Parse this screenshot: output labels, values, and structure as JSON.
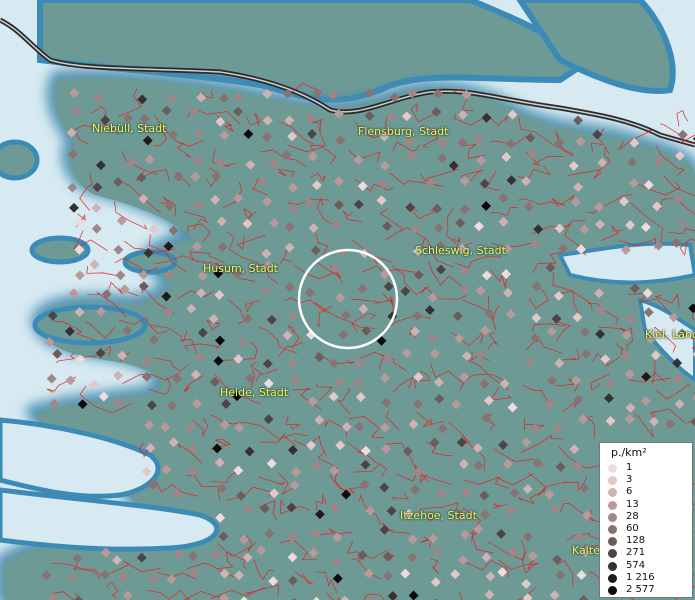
{
  "map": {
    "towns": [
      {
        "name": "Niebüll, Stadt"
      },
      {
        "name": "Flensburg, Stadt"
      },
      {
        "name": "Schleswig, Stadt"
      },
      {
        "name": "Husum, Stadt"
      },
      {
        "name": "Kiel, Lands"
      },
      {
        "name": "Heide, Stadt"
      },
      {
        "name": "Itzehoe, Stadt"
      },
      {
        "name": "Kalte"
      }
    ],
    "colors": {
      "sea": "#d8eaf1",
      "land": "#6e9a96",
      "boundary": "#e02424",
      "coastline": "#3b8bb6"
    }
  },
  "legend": {
    "title": "p./km²",
    "entries": [
      {
        "value": "1",
        "color": "#eedcdc"
      },
      {
        "value": "3",
        "color": "#e2c8c8"
      },
      {
        "value": "6",
        "color": "#cfb2b2"
      },
      {
        "value": "13",
        "color": "#b89a9a"
      },
      {
        "value": "28",
        "color": "#a08686"
      },
      {
        "value": "60",
        "color": "#887272"
      },
      {
        "value": "128",
        "color": "#6c5c5c"
      },
      {
        "value": "271",
        "color": "#4e4444"
      },
      {
        "value": "574",
        "color": "#363030"
      },
      {
        "value": "1 216",
        "color": "#1f1b1b"
      },
      {
        "value": "2 577",
        "color": "#0c0a0a"
      }
    ]
  }
}
